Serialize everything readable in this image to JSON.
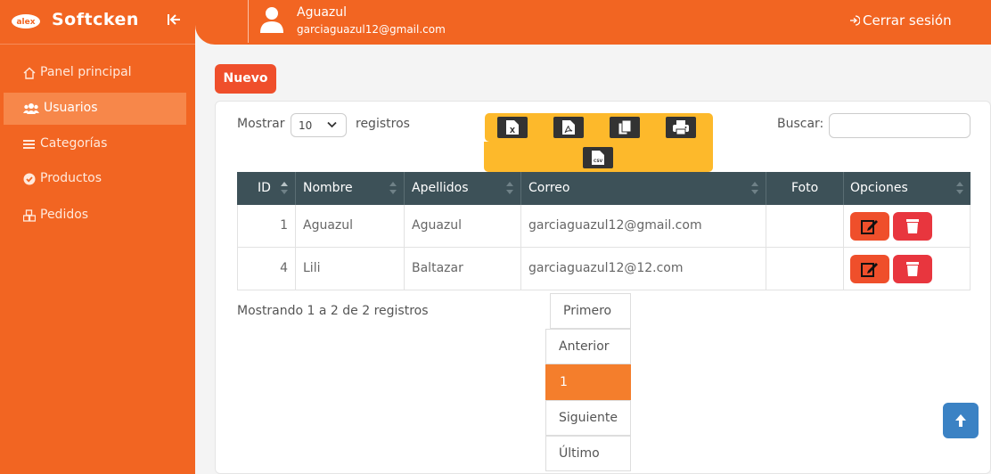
{
  "brand": {
    "name": "Softcken",
    "logo_text": "alex"
  },
  "sidebar": {
    "items": [
      {
        "label": "Panel principal",
        "icon": "home-icon"
      },
      {
        "label": "Usuarios",
        "icon": "users-icon",
        "active": true
      },
      {
        "label": "Categorías",
        "icon": "list-icon"
      },
      {
        "label": "Productos",
        "icon": "check-circle-icon"
      },
      {
        "label": "Pedidos",
        "icon": "boxes-icon"
      }
    ]
  },
  "topbar": {
    "user_name": "Aguazul",
    "user_email": "garciaguazul12@gmail.com",
    "logout_label": "Cerrar sesión"
  },
  "actions": {
    "new_label": "Nuevo"
  },
  "table_controls": {
    "show_label": "Mostrar",
    "page_size": "10",
    "records_label": "registros",
    "search_label": "Buscar:",
    "search_value": ""
  },
  "export_buttons": [
    "excel-icon",
    "pdf-icon",
    "copy-icon",
    "print-icon",
    "csv-icon"
  ],
  "table": {
    "columns": [
      "ID",
      "Nombre",
      "Apellidos",
      "Correo",
      "Foto",
      "Opciones"
    ],
    "rows": [
      {
        "id": "1",
        "nombre": "Aguazul",
        "apellidos": "Aguazul",
        "correo": "garciaguazul12@gmail.com",
        "foto": ""
      },
      {
        "id": "4",
        "nombre": "Lili",
        "apellidos": "Baltazar",
        "correo": "garciaguazul12@12.com",
        "foto": ""
      }
    ]
  },
  "table_info": "Mostrando 1 a 2 de 2 registros",
  "pagination": {
    "first": "Primero",
    "previous": "Anterior",
    "current": "1",
    "next": "Siguiente",
    "last": "Último"
  },
  "colors": {
    "primary": "#f26522",
    "active_nav": "#f7874a",
    "table_header": "#3d5158",
    "export_bar": "#fdb92b",
    "edit": "#ef4f2b",
    "delete": "#e8363e",
    "scroll_top": "#3b82c4"
  }
}
